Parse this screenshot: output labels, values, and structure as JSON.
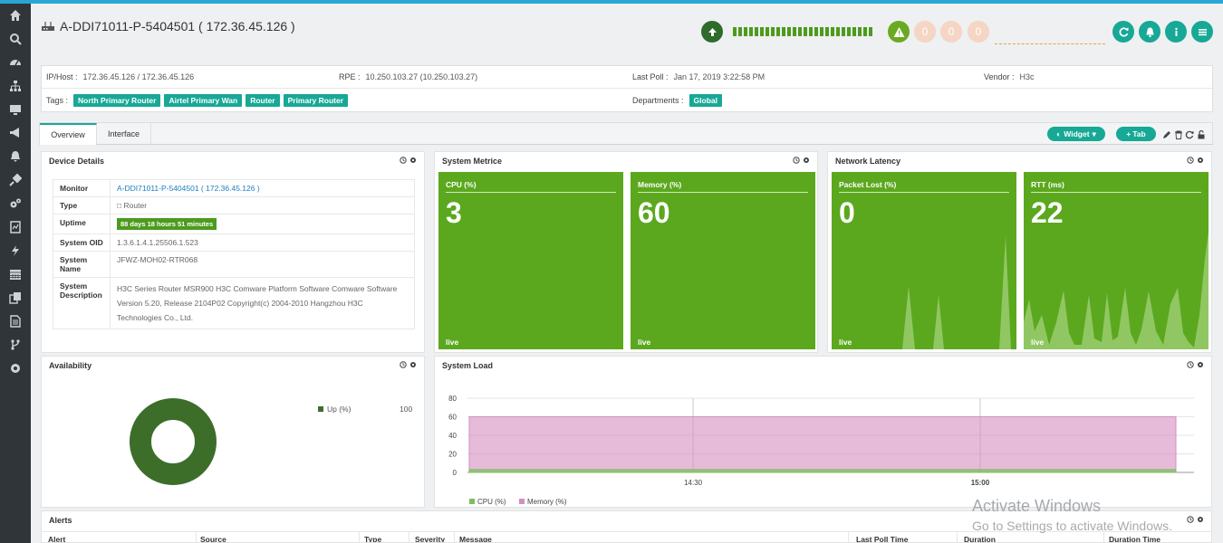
{
  "header": {
    "title": "A-DDI71011-P-5404501 ( 172.36.45.126 )",
    "severity_counts": [
      "0",
      "0",
      "0"
    ],
    "colors": {
      "accent": "#17a896",
      "status_green": "#4d9b1e",
      "tile_green": "#5ba81e"
    }
  },
  "sidebar": {
    "items": [
      {
        "icon": "home-icon"
      },
      {
        "icon": "search-icon"
      },
      {
        "icon": "dashboard-icon"
      },
      {
        "icon": "sitemap-icon"
      },
      {
        "icon": "monitor-icon"
      },
      {
        "icon": "megaphone-icon"
      },
      {
        "icon": "bell-icon"
      },
      {
        "icon": "plug-icon"
      },
      {
        "icon": "cogs-icon"
      },
      {
        "icon": "report-icon"
      },
      {
        "icon": "bolt-icon"
      },
      {
        "icon": "calendar-icon"
      },
      {
        "icon": "copy-icon"
      },
      {
        "icon": "document-icon"
      },
      {
        "icon": "flow-icon"
      },
      {
        "icon": "settings-icon"
      }
    ]
  },
  "info": {
    "ip_label": "IP/Host :",
    "ip_value": "172.36.45.126 / 172.36.45.126",
    "rpe_label": "RPE :",
    "rpe_value": "10.250.103.27 (10.250.103.27)",
    "lastpoll_label": "Last Poll :",
    "lastpoll_value": "Jan 17, 2019 3:22:58 PM",
    "vendor_label": "Vendor :",
    "vendor_value": "H3c",
    "tags_label": "Tags :",
    "tags": [
      "North Primary Router",
      "Airtel Primary Wan",
      "Router",
      "Primary Router"
    ],
    "departments_label": "Departments :",
    "departments": [
      "Global"
    ]
  },
  "tabs": {
    "overview": "Overview",
    "interface": "Interface",
    "widget_btn": "Widget",
    "tab_btn": "Tab"
  },
  "device_details": {
    "title": "Device Details",
    "rows": [
      {
        "key": "Monitor",
        "value": "A-DDI71011-P-5404501 ( 172.36.45.126 )"
      },
      {
        "key": "Type",
        "value": "Router"
      },
      {
        "key": "Uptime",
        "value": "88 days 18 hours 51 minutes"
      },
      {
        "key": "System OID",
        "value": "1.3.6.1.4.1.25506.1.523"
      },
      {
        "key": "System Name",
        "value": "JFWZ-MOH02-RTR068"
      },
      {
        "key": "System Description",
        "value": "H3C Series Router MSR900 H3C Comware Platform Software Comware Software Version 5.20, Release 2104P02 Copyright(c) 2004-2010 Hangzhou H3C Technologies Co., Ltd."
      }
    ]
  },
  "system_metrics": {
    "title": "System Metrice",
    "tiles": [
      {
        "label": "CPU (%)",
        "value": "3",
        "live": "live"
      },
      {
        "label": "Memory (%)",
        "value": "60",
        "live": "live"
      }
    ]
  },
  "network_latency": {
    "title": "Network Latency",
    "tiles": [
      {
        "label": "Packet Lost (%)",
        "value": "0",
        "live": "live"
      },
      {
        "label": "RTT (ms)",
        "value": "22",
        "live": "live"
      }
    ]
  },
  "availability": {
    "title": "Availability",
    "legend_label": "Up (%)",
    "legend_value": "100",
    "color": "#3c6e2a"
  },
  "system_load": {
    "title": "System Load",
    "legend": [
      "CPU (%)",
      "Memory (%)"
    ],
    "colors": {
      "cpu": "#7cbf5c",
      "memory": "#d48ec0"
    }
  },
  "alerts": {
    "title": "Alerts",
    "columns": [
      "Alert",
      "Source",
      "Type",
      "Severity",
      "Message",
      "Last Poll Time",
      "Duration",
      "Duration Time"
    ]
  },
  "watermark": {
    "line1": "Activate Windows",
    "line2": "Go to Settings to activate Windows."
  },
  "chart_data": {
    "type": "area",
    "title": "System Load",
    "x": [
      "14:30",
      "15:00"
    ],
    "ylim": [
      0,
      80
    ],
    "yticks": [
      0,
      20,
      40,
      60,
      80
    ],
    "grid": true,
    "legend_position": "bottom-left",
    "series": [
      {
        "name": "CPU (%)",
        "values": [
          3,
          3,
          3
        ]
      },
      {
        "name": "Memory (%)",
        "values": [
          60,
          60,
          60
        ]
      }
    ]
  }
}
